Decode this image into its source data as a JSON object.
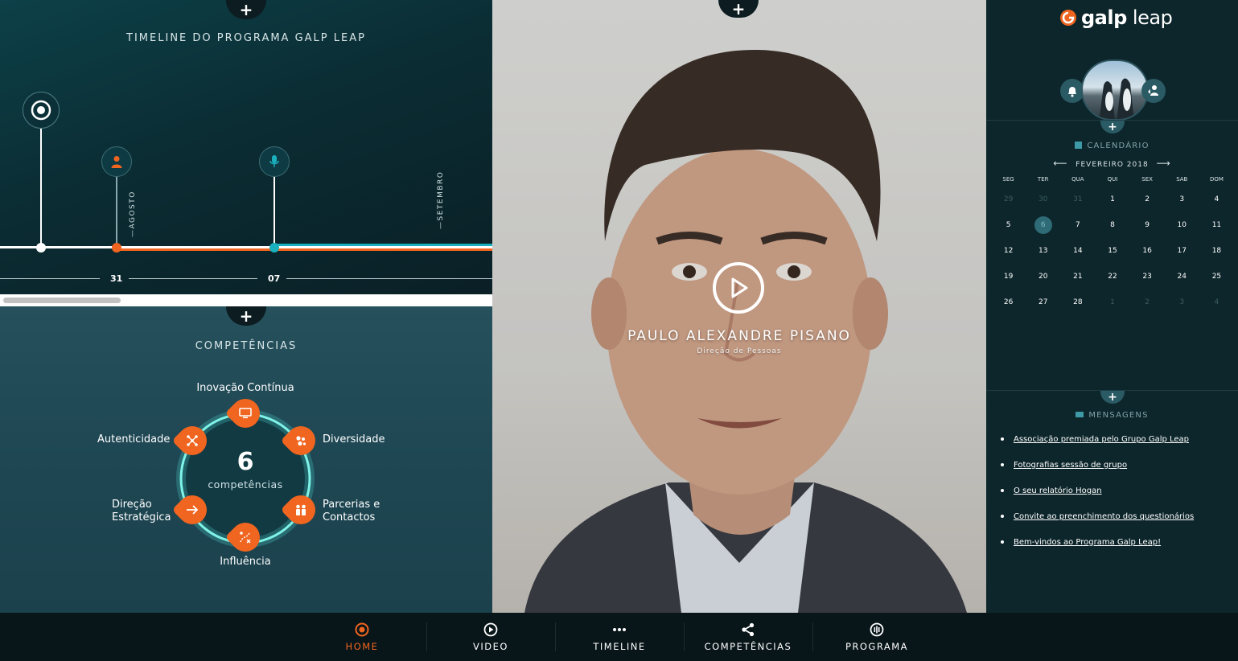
{
  "timeline": {
    "title": "TIMELINE DO PROGRAMA GALP LEAP",
    "months": [
      "AGOSTO",
      "SETEMBRO"
    ],
    "dates": [
      "31",
      "07"
    ],
    "markers": [
      "target-icon",
      "person-icon",
      "microphone-icon"
    ],
    "colors": {
      "progress": "#f0651f",
      "future": "#1ab0bd",
      "past": "#ffffff"
    }
  },
  "competencias": {
    "title": "COMPETÊNCIAS",
    "count": "6",
    "count_label": "competências",
    "items": [
      {
        "label": "Inovação Contínua",
        "icon": "monitor-icon"
      },
      {
        "label": "Diversidade",
        "icon": "molecule-icon"
      },
      {
        "label": "Parcerias e Contactos",
        "icon": "people-icon"
      },
      {
        "label": "Influência",
        "icon": "strategy-icon"
      },
      {
        "label": "Direção Estratégica",
        "icon": "arrow-right-icon"
      },
      {
        "label": "Autenticidade",
        "icon": "network-icon"
      }
    ],
    "label_lines": {
      "parcerias_1": "Parcerias e",
      "parcerias_2": "Contactos",
      "direcao_1": "Direção",
      "direcao_2": "Estratégica"
    },
    "accent": "#f0651f"
  },
  "video": {
    "presenter_name": "PAULO ALEXANDRE PISANO",
    "presenter_role": "Direção de Pessoas"
  },
  "sidebar": {
    "logo": {
      "bold": "galp",
      "light": "leap"
    },
    "calendar": {
      "title": "CALENDÁRIO",
      "month": "FEVEREIRO 2018",
      "weekdays": [
        "SEG",
        "TER",
        "QUA",
        "QUI",
        "SEX",
        "SAB",
        "DOM"
      ],
      "weeks": [
        [
          "29",
          "30",
          "31",
          "1",
          "2",
          "3",
          "4"
        ],
        [
          "5",
          "6",
          "7",
          "8",
          "9",
          "10",
          "11"
        ],
        [
          "12",
          "13",
          "14",
          "15",
          "16",
          "17",
          "18"
        ],
        [
          "19",
          "20",
          "21",
          "22",
          "23",
          "24",
          "25"
        ],
        [
          "26",
          "27",
          "28",
          "1",
          "2",
          "3",
          "4"
        ]
      ],
      "today": "6"
    },
    "messages": {
      "title": "MENSAGENS",
      "items": [
        "Associação premiada pelo Grupo Galp Leap",
        "Fotografias sessão de grupo",
        "O seu relatório Hogan",
        "Convite ao preenchimento dos questionários",
        "Bem-vindos ao Programa Galp Leap!"
      ]
    }
  },
  "nav": {
    "items": [
      {
        "label": "HOME",
        "icon": "target-icon",
        "active": true
      },
      {
        "label": "VIDEO",
        "icon": "play-icon",
        "active": false
      },
      {
        "label": "TIMELINE",
        "icon": "dots-icon",
        "active": false
      },
      {
        "label": "COMPETÊNCIAS",
        "icon": "share-icon",
        "active": false
      },
      {
        "label": "PROGRAMA",
        "icon": "program-icon",
        "active": false
      }
    ]
  }
}
